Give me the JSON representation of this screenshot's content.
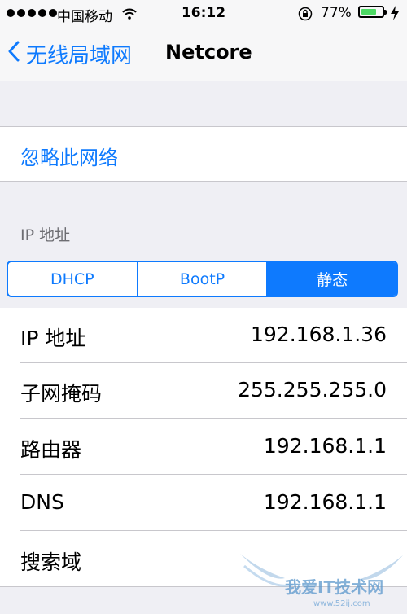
{
  "status_bar": {
    "carrier": "中国移动",
    "time": "16:12",
    "battery_percent_text": "77%",
    "battery_level": 0.77,
    "battery_color": "#4cd964",
    "icons": [
      "signal-dots-icon",
      "wifi-icon",
      "rotation-lock-icon",
      "battery-icon",
      "charging-bolt-icon"
    ]
  },
  "nav": {
    "back_label": "无线局域网",
    "title": "Netcore",
    "accent_color": "#0e7afe"
  },
  "forget_network": {
    "label": "忽略此网络"
  },
  "ip_section": {
    "header": "IP 地址"
  },
  "segmented": {
    "options": [
      "DHCP",
      "BootP",
      "静态"
    ],
    "selected": "静态"
  },
  "settings": [
    {
      "label": "IP 地址",
      "value": "192.168.1.36"
    },
    {
      "label": "子网掩码",
      "value": "255.255.255.0"
    },
    {
      "label": "路由器",
      "value": "192.168.1.1"
    },
    {
      "label": "DNS",
      "value": "192.168.1.1"
    },
    {
      "label": "搜索域",
      "value": ""
    }
  ],
  "watermark": {
    "text": "我爱IT技术网",
    "url_text": "www.52ij.com"
  }
}
